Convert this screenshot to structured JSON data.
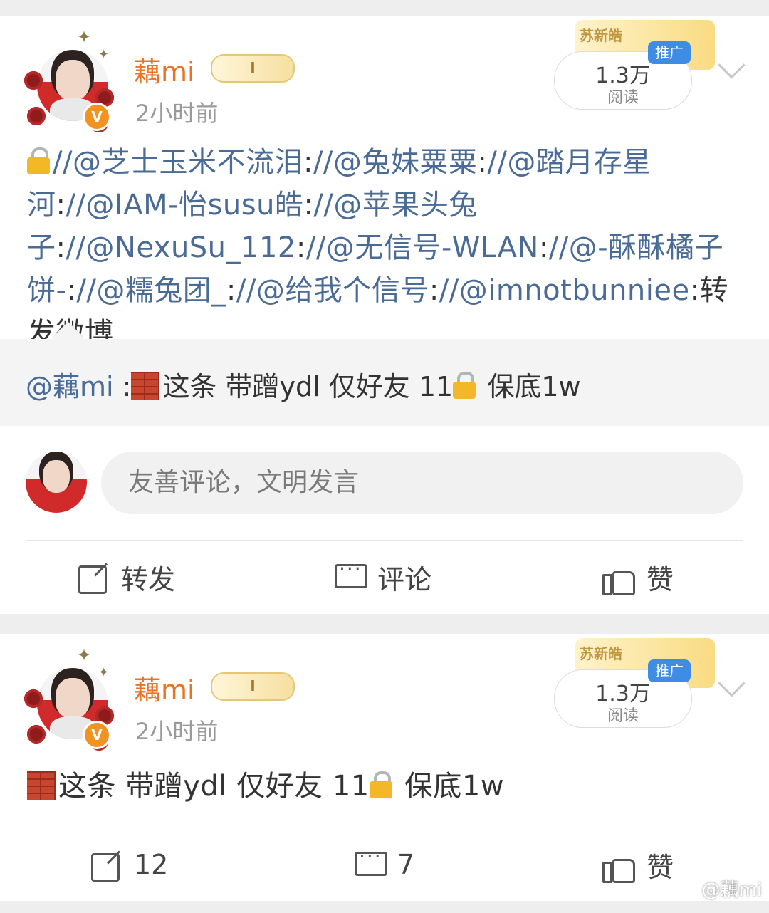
{
  "posts": [
    {
      "username": "藕mi",
      "level_badge": "Ⅰ",
      "timestamp": "2小时前",
      "ad_name": "苏新皓",
      "ad_tag": "推广",
      "read_count": "1.3万",
      "read_label": "阅读",
      "text_segments": {
        "s1": "//@芝士玉米不流泪",
        "s2": ":",
        "s3": "//@兔妹粟粟",
        "s4": ":",
        "s5": "//@踏月存星河",
        "s6": ":",
        "s7": "//@IAM-怡susu皓",
        "s8": ":",
        "s9": "//@苹果头兔子",
        "s10": ":",
        "s11": "//@NexuSu_112",
        "s12": ":",
        "s13": "//@无信号-WLAN",
        "s14": ":",
        "s15": "//@-酥酥橘子饼-",
        "s16": ":",
        "s17": "//@糯兔团_",
        "s18": ":",
        "s19": "//@给我个信号",
        "s20": ":",
        "s21": "//@imnotbunniee",
        "s22": ":转发微博"
      },
      "repost": {
        "author": "@藕mi",
        "sep": " :",
        "text_a": "这条 带蹭ydl 仅好友 11",
        "text_b": " 保底1w"
      },
      "comment_placeholder": "友善评论，文明发言",
      "actions": {
        "repost": "转发",
        "comment": "评论",
        "like": "赞"
      }
    },
    {
      "username": "藕mi",
      "level_badge": "Ⅰ",
      "timestamp": "2小时前",
      "ad_name": "苏新皓",
      "ad_tag": "推广",
      "read_count": "1.3万",
      "read_label": "阅读",
      "text_a": "这条 带蹭ydl 仅好友 11",
      "text_b": " 保底1w",
      "actions": {
        "repost": "12",
        "comment": "7",
        "like": "赞"
      }
    }
  ],
  "watermark": "@藕mi",
  "colors": {
    "username": "#ec7223",
    "mention": "#4a6b96",
    "ad_tag": "#3f8ce5",
    "vip": "#f29220"
  }
}
